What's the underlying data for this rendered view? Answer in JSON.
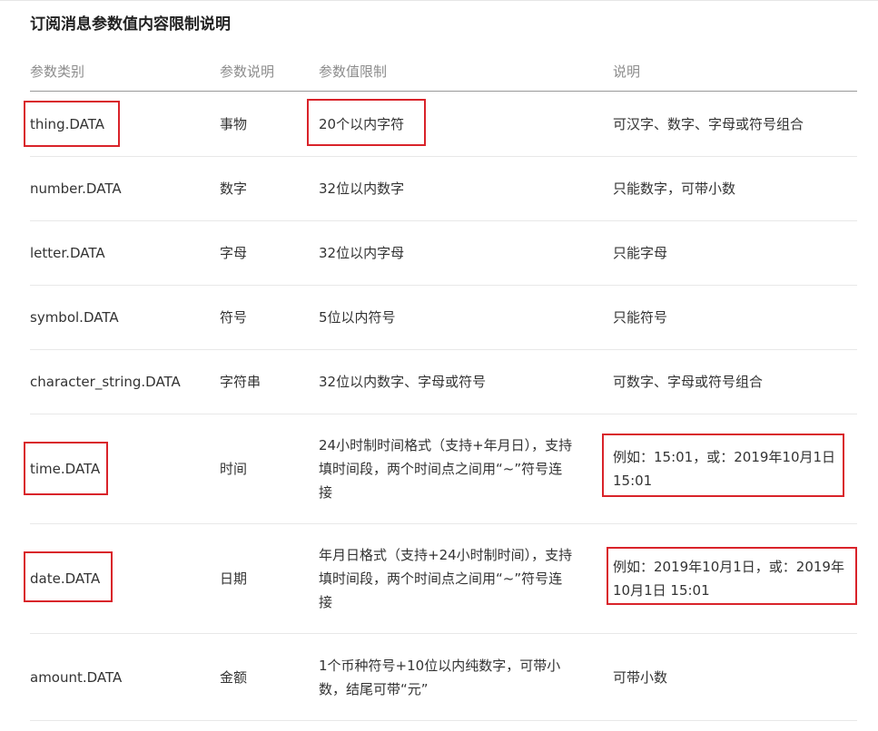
{
  "title": "订阅消息参数值内容限制说明",
  "table": {
    "headers": [
      "参数类别",
      "参数说明",
      "参数值限制",
      "说明"
    ],
    "rows": [
      {
        "type": "thing.DATA",
        "desc": "事物",
        "limit": "20个以内字符",
        "note": "可汉字、数字、字母或符号组合"
      },
      {
        "type": "number.DATA",
        "desc": "数字",
        "limit": "32位以内数字",
        "note": "只能数字，可带小数"
      },
      {
        "type": "letter.DATA",
        "desc": "字母",
        "limit": "32位以内字母",
        "note": "只能字母"
      },
      {
        "type": "symbol.DATA",
        "desc": "符号",
        "limit": "5位以内符号",
        "note": "只能符号"
      },
      {
        "type": "character_string.DATA",
        "desc": "字符串",
        "limit": "32位以内数字、字母或符号",
        "note": "可数字、字母或符号组合"
      },
      {
        "type": "time.DATA",
        "desc": "时间",
        "limit": "24小时制时间格式（支持+年月日），支持填时间段，两个时间点之间用“~”符号连接",
        "note": "例如：15:01，或：2019年10月1日 15:01"
      },
      {
        "type": "date.DATA",
        "desc": "日期",
        "limit": "年月日格式（支持+24小时制时间），支持填时间段，两个时间点之间用“~”符号连接",
        "note": "例如：2019年10月1日，或：2019年10月1日 15:01"
      },
      {
        "type": "amount.DATA",
        "desc": "金额",
        "limit": "1个币种符号+10位以内纯数字，可带小数，结尾可带“元”",
        "note": "可带小数"
      }
    ]
  },
  "highlight_color": "#d9232a"
}
